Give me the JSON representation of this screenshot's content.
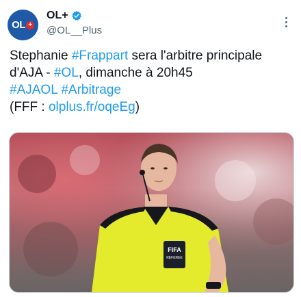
{
  "author": {
    "display_name": "OL+",
    "handle": "@OL__Plus",
    "avatar_text": "OL",
    "avatar_plus": "+"
  },
  "tweet": {
    "line1_a": "Stephanie ",
    "line1_tag": "#Frappart",
    "line1_b": " sera l'arbitre principale",
    "line2_a": "d'AJA - ",
    "line2_tag": "#OL",
    "line2_b": ", dimanche à 20h45",
    "line3_tag1": "#AJAOL",
    "line3_tag2": "#Arbitrage",
    "line4_a": "(FFF : ",
    "line4_link": "olplus.fr/oqeEg",
    "line4_b": ")"
  },
  "media": {
    "badge_brand": "FIFA",
    "badge_sub": "REFEREE"
  },
  "colors": {
    "link": "#1d9bf0",
    "verified": "#1d9bf0",
    "avatar_bg": "#1e5aa8",
    "jersey": "#e4ea2c"
  }
}
